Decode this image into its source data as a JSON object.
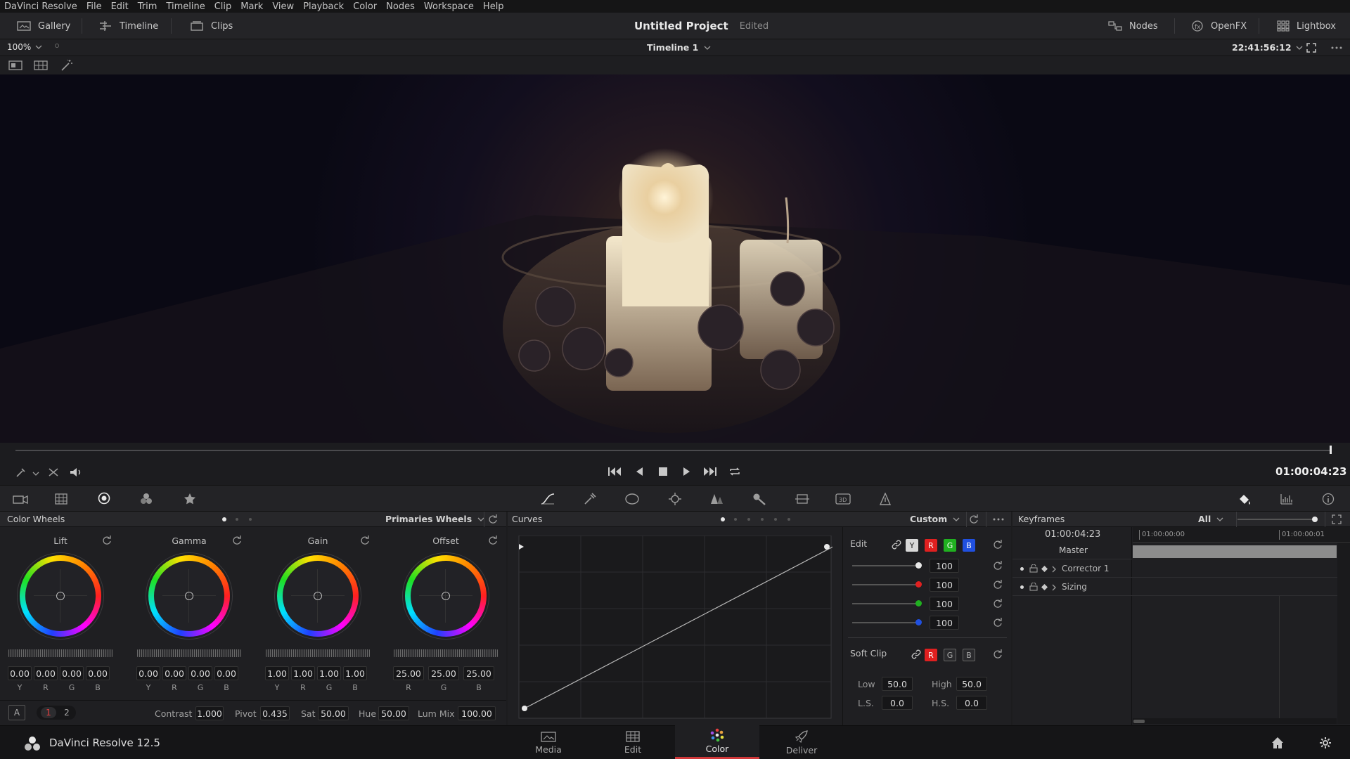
{
  "menu": [
    "DaVinci Resolve",
    "File",
    "Edit",
    "Trim",
    "Timeline",
    "Clip",
    "Mark",
    "View",
    "Playback",
    "Color",
    "Nodes",
    "Workspace",
    "Help"
  ],
  "toolbar": {
    "gallery": "Gallery",
    "timeline": "Timeline",
    "clips": "Clips",
    "project_title": "Untitled Project",
    "project_status": "Edited",
    "nodes": "Nodes",
    "openfx": "OpenFX",
    "lightbox": "Lightbox"
  },
  "viewer": {
    "zoom": "100%",
    "timeline_name": "Timeline 1",
    "source_timecode": "22:41:56:12",
    "record_timecode": "01:00:04:23",
    "playhead_fraction": 1.0
  },
  "color_wheels": {
    "title": "Color Wheels",
    "mode": "Primaries Wheels",
    "wheels": [
      {
        "name": "Lift",
        "values": [
          "0.00",
          "0.00",
          "0.00",
          "0.00"
        ],
        "channels": [
          "Y",
          "R",
          "G",
          "B"
        ]
      },
      {
        "name": "Gamma",
        "values": [
          "0.00",
          "0.00",
          "0.00",
          "0.00"
        ],
        "channels": [
          "Y",
          "R",
          "G",
          "B"
        ]
      },
      {
        "name": "Gain",
        "values": [
          "1.00",
          "1.00",
          "1.00",
          "1.00"
        ],
        "channels": [
          "Y",
          "R",
          "G",
          "B"
        ]
      },
      {
        "name": "Offset",
        "values": [
          "25.00",
          "25.00",
          "25.00"
        ],
        "channels": [
          "R",
          "G",
          "B"
        ]
      }
    ],
    "page_a": "A",
    "page_1": "1",
    "page_2": "2",
    "contrast_label": "Contrast",
    "contrast": "1.000",
    "pivot_label": "Pivot",
    "pivot": "0.435",
    "sat_label": "Sat",
    "sat": "50.00",
    "hue_label": "Hue",
    "hue": "50.00",
    "lummix_label": "Lum Mix",
    "lummix": "100.00"
  },
  "curves": {
    "title": "Curves",
    "mode": "Custom",
    "edit_label": "Edit",
    "channels": [
      "Y",
      "R",
      "G",
      "B"
    ],
    "intensity": [
      "100",
      "100",
      "100",
      "100"
    ],
    "softclip_label": "Soft Clip",
    "softclip_channels": [
      "R",
      "G",
      "B"
    ],
    "low_label": "Low",
    "low": "50.0",
    "high_label": "High",
    "high": "50.0",
    "ls_label": "L.S.",
    "ls": "0.0",
    "hs_label": "H.S.",
    "hs": "0.0"
  },
  "keyframes": {
    "title": "Keyframes",
    "filter": "All",
    "timecode": "01:00:04:23",
    "ruler_start": "01:00:00:00",
    "ruler_next": "01:00:00:01",
    "tracks": [
      "Master",
      "Corrector 1",
      "Sizing"
    ]
  },
  "bottom": {
    "app_name": "DaVinci Resolve 12.5",
    "pages": [
      "Media",
      "Edit",
      "Color",
      "Deliver"
    ],
    "active_page": "Color"
  },
  "colors": {
    "accent_red": "#d0383a",
    "channel_red": "#e02020",
    "channel_green": "#20b020",
    "channel_blue": "#2050e0"
  }
}
